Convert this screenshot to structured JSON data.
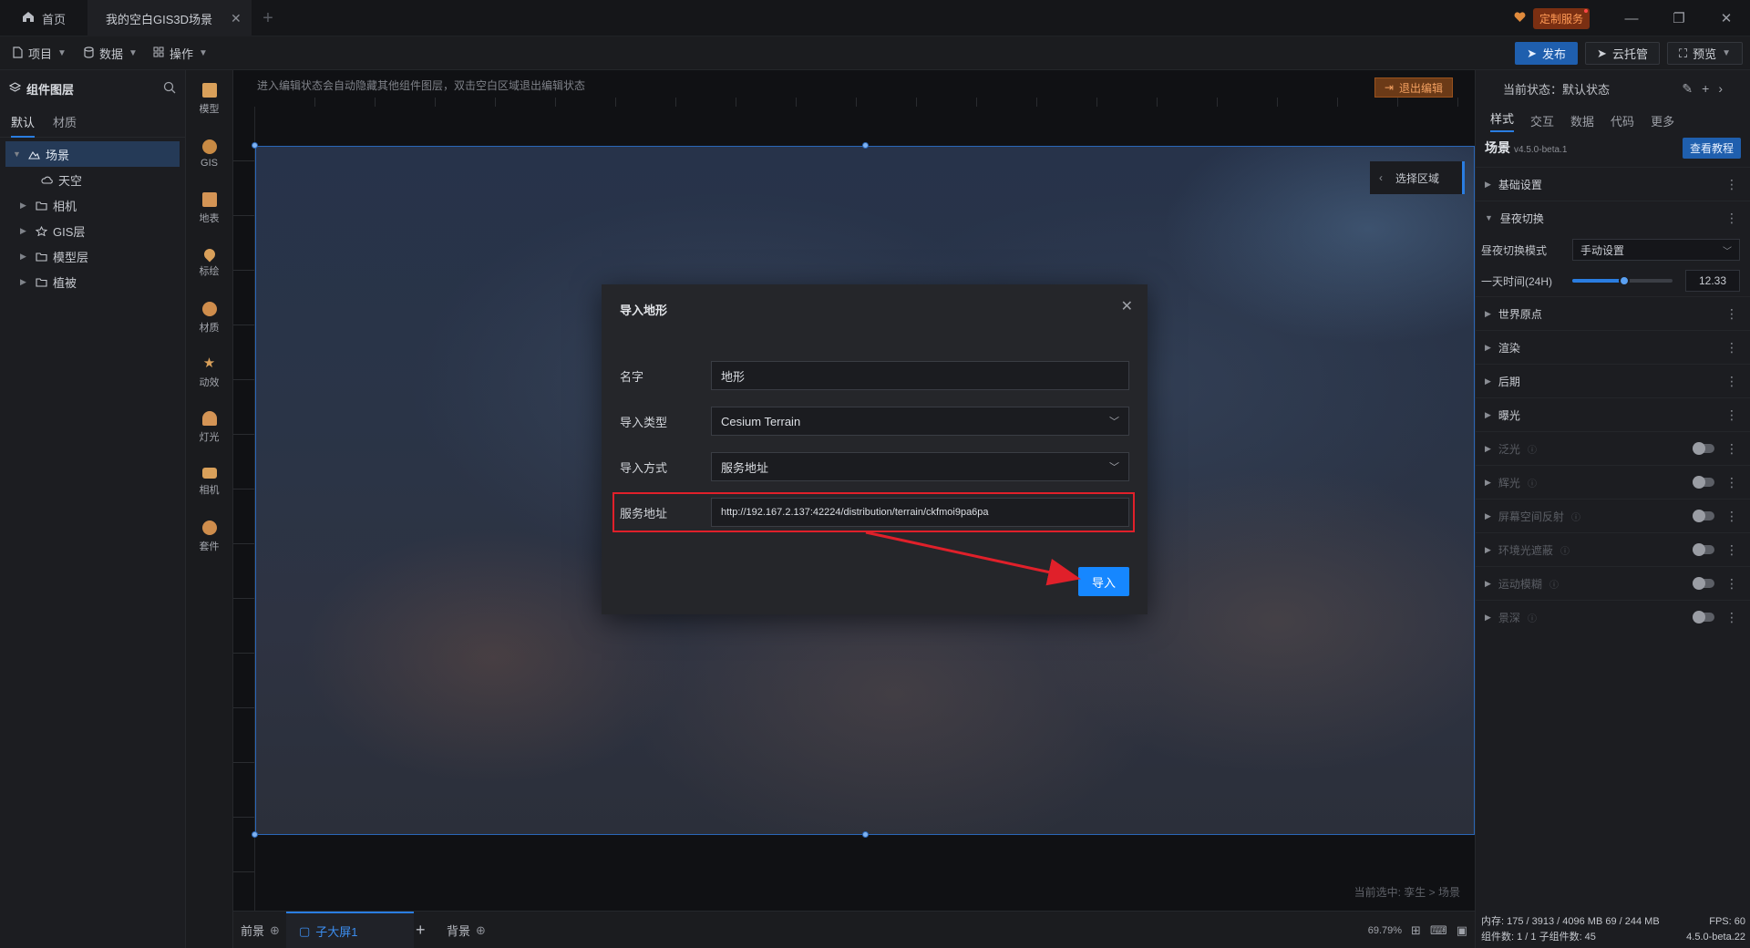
{
  "titlebar": {
    "home_label": "首页",
    "project_tab": "我的空白GIS3D场景",
    "add_tab": "+",
    "custom_service": "定制服务",
    "controls": {
      "minimize": "—",
      "restore": "❐",
      "close": "✕"
    }
  },
  "toolbar": {
    "menus": [
      {
        "label": "项目",
        "icon": "file-icon"
      },
      {
        "label": "数据",
        "icon": "database-icon"
      },
      {
        "label": "操作",
        "icon": "grid-icon"
      }
    ],
    "publish": "发布",
    "cloud_host": "云托管",
    "preview": "预览"
  },
  "layers": {
    "title": "组件图层",
    "tabs": [
      "默认",
      "材质"
    ],
    "tree": [
      {
        "label": "场景",
        "icon": "scene-icon",
        "expanded": true,
        "selected": true,
        "level": 0
      },
      {
        "label": "天空",
        "icon": "sky-icon",
        "level": 1
      },
      {
        "label": "相机",
        "icon": "folder-icon",
        "level": 1,
        "collapsible": true
      },
      {
        "label": "GIS层",
        "icon": "gis-layer-icon",
        "level": 1,
        "collapsible": true
      },
      {
        "label": "模型层",
        "icon": "folder-icon",
        "level": 1,
        "collapsible": true
      },
      {
        "label": "植被",
        "icon": "folder-icon",
        "level": 1,
        "collapsible": true
      }
    ]
  },
  "strip": [
    {
      "label": "模型",
      "color": "#d9a05a"
    },
    {
      "label": "GIS",
      "color": "#c88a44"
    },
    {
      "label": "地表",
      "color": "#d49455"
    },
    {
      "label": "标绘",
      "color": "#d9a05a"
    },
    {
      "label": "材质",
      "color": "#cf8d4c"
    },
    {
      "label": "动效",
      "color": "#d9a05a"
    },
    {
      "label": "灯光",
      "color": "#d49455"
    },
    {
      "label": "相机",
      "color": "#d9a05a"
    },
    {
      "label": "套件",
      "color": "#cf8d4c"
    }
  ],
  "canvas": {
    "hint": "进入编辑状态会自动隐藏其他组件图层，双击空白区域退出编辑状态",
    "exit_edit": "退出编辑",
    "select_area": "选择区域",
    "current_selection": "当前选中: 孪生 > 场景"
  },
  "bottombar": {
    "foreground": "前景",
    "active_screen": "子大屏1",
    "add": "+",
    "background": "背景",
    "zoom": "69.79%"
  },
  "rpanel": {
    "state": "当前状态：默认状态",
    "tabs": [
      "样式",
      "交互",
      "数据",
      "代码",
      "更多"
    ],
    "title": "场景",
    "version": "v4.5.0-beta.1",
    "tutorial": "查看教程",
    "sections_top": [
      {
        "label": "基础设置",
        "expanded": false
      }
    ],
    "daynight": {
      "label": "昼夜切换",
      "mode_label": "昼夜切换模式",
      "mode_value": "手动设置",
      "time_label": "一天时间(24H)",
      "time_value": "12.33",
      "time_fraction": 0.514
    },
    "sections_bottom": [
      {
        "label": "世界原点",
        "dim": false,
        "switch": false
      },
      {
        "label": "渲染",
        "dim": false,
        "switch": false
      },
      {
        "label": "后期",
        "dim": false,
        "switch": false
      },
      {
        "label": "曝光",
        "dim": false,
        "switch": false
      },
      {
        "label": "泛光",
        "dim": true,
        "switch": true
      },
      {
        "label": "辉光",
        "dim": true,
        "switch": true
      },
      {
        "label": "屏幕空间反射",
        "dim": true,
        "switch": true
      },
      {
        "label": "环境光遮蔽",
        "dim": true,
        "switch": true
      },
      {
        "label": "运动模糊",
        "dim": true,
        "switch": true
      },
      {
        "label": "景深",
        "dim": true,
        "switch": true
      }
    ],
    "status": {
      "memory": "内存: 175 / 3913 / 4096 MB  69 / 244 MB",
      "fps": "FPS: 60",
      "components": "组件数: 1 / 1   子组件数: 45",
      "build": "4.5.0-beta.22"
    }
  },
  "modal": {
    "title": "导入地形",
    "close": "✕",
    "fields": [
      {
        "label": "名字",
        "value": "地形",
        "type": "input"
      },
      {
        "label": "导入类型",
        "value": "Cesium Terrain",
        "type": "select"
      },
      {
        "label": "导入方式",
        "value": "服务地址",
        "type": "select"
      },
      {
        "label": "服务地址",
        "value": "http://192.167.2.137:42224/distribution/terrain/ckfmoi9pa6pa",
        "type": "input"
      }
    ],
    "import_button": "导入"
  },
  "colors": {
    "accent": "#1687ff",
    "highlight": "#e0202a",
    "selection": "#2a67b8"
  }
}
